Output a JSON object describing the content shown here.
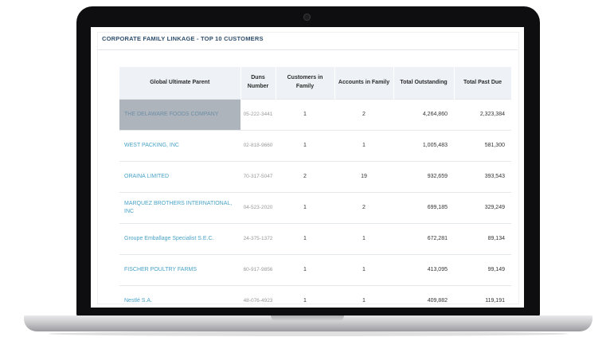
{
  "panel": {
    "title": "CORPORATE FAMILY LINKAGE - TOP 10 CUSTOMERS"
  },
  "table": {
    "headers": {
      "parent": "Global Ultimate Parent",
      "duns": "Duns Number",
      "customers": "Customers in Family",
      "accounts": "Accounts in Family",
      "outstanding": "Total Outstanding",
      "past_due": "Total Past Due"
    },
    "rows": [
      {
        "parent": "THE DELAWARE FOODS COMPANY",
        "duns": "05-222-3441",
        "customers": "1",
        "accounts": "2",
        "outstanding": "4,264,860",
        "past_due": "2,323,384"
      },
      {
        "parent": "WEST PACKING, INC",
        "duns": "02-818-9660",
        "customers": "1",
        "accounts": "1",
        "outstanding": "1,005,483",
        "past_due": "581,300"
      },
      {
        "parent": "ORAINA LIMITED",
        "duns": "70-317-5047",
        "customers": "2",
        "accounts": "19",
        "outstanding": "932,659",
        "past_due": "393,543"
      },
      {
        "parent": "MARQUEZ BROTHERS INTERNATIONAL, INC",
        "duns": "04-523-2020",
        "customers": "1",
        "accounts": "2",
        "outstanding": "699,185",
        "past_due": "329,249"
      },
      {
        "parent": "Groupe Emballage Specialist S.E.C.",
        "duns": "24-375-1372",
        "customers": "1",
        "accounts": "1",
        "outstanding": "672,281",
        "past_due": "89,134"
      },
      {
        "parent": "FISCHER POULTRY FARMS",
        "duns": "60-917-9856",
        "customers": "1",
        "accounts": "1",
        "outstanding": "413,095",
        "past_due": "99,149"
      },
      {
        "parent": "Nestlé S.A.",
        "duns": "48-076-4923",
        "customers": "1",
        "accounts": "1",
        "outstanding": "409,882",
        "past_due": "119,191"
      }
    ]
  },
  "colors": {
    "link": "#4aa3c7",
    "header_bg": "#eef2f6",
    "title": "#2f4f6f",
    "selected_row": "#aeb4bb"
  }
}
